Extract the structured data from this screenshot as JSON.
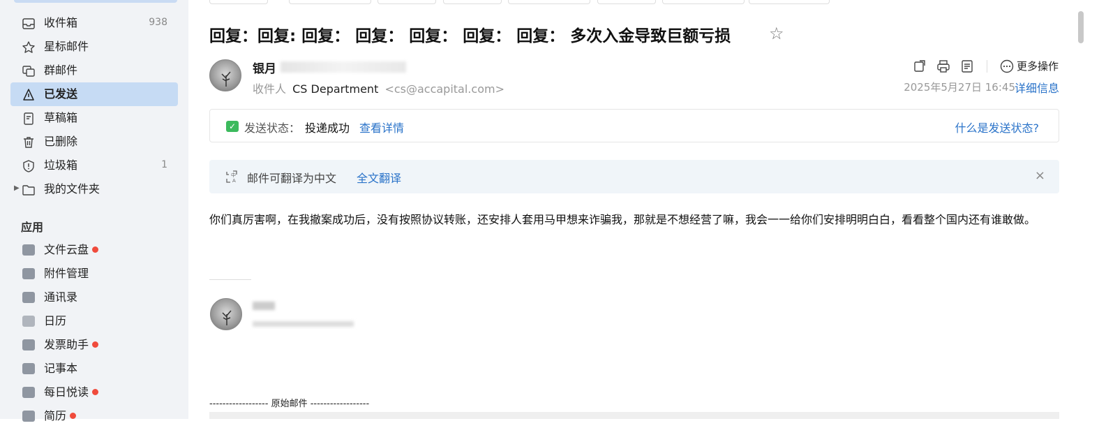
{
  "sidebar": {
    "folders": [
      {
        "label": "收件箱",
        "count": "938",
        "icon": "inbox-icon",
        "active": false
      },
      {
        "label": "星标邮件",
        "count": "",
        "icon": "star-icon",
        "active": false
      },
      {
        "label": "群邮件",
        "count": "",
        "icon": "group-mail-icon",
        "active": false
      },
      {
        "label": "已发送",
        "count": "",
        "icon": "sent-icon",
        "active": true
      },
      {
        "label": "草稿箱",
        "count": "",
        "icon": "draft-icon",
        "active": false
      },
      {
        "label": "已删除",
        "count": "",
        "icon": "trash-icon",
        "active": false
      },
      {
        "label": "垃圾箱",
        "count": "1",
        "icon": "shield-icon",
        "active": false
      },
      {
        "label": "我的文件夹",
        "count": "",
        "icon": "folder-icon",
        "active": false
      }
    ],
    "apps_title": "应用",
    "apps": [
      {
        "label": "文件云盘",
        "badge": true,
        "icon": "cloud-drive-icon"
      },
      {
        "label": "附件管理",
        "badge": false,
        "icon": "attachment-icon"
      },
      {
        "label": "通讯录",
        "badge": false,
        "icon": "contacts-icon"
      },
      {
        "label": "日历",
        "badge": false,
        "icon": "calendar-icon"
      },
      {
        "label": "发票助手",
        "badge": true,
        "icon": "invoice-icon"
      },
      {
        "label": "记事本",
        "badge": false,
        "icon": "notepad-icon"
      },
      {
        "label": "每日悦读",
        "badge": true,
        "icon": "reading-icon"
      },
      {
        "label": "简历",
        "badge": true,
        "icon": "resume-icon"
      }
    ]
  },
  "mail": {
    "subject": "回复：回复: 回复： 回复： 回复： 回复： 回复： 多次入金导致巨额亏损",
    "sender_name": "银月",
    "recipient_label": "收件人",
    "recipient_name": "CS Department",
    "recipient_email": "<cs@accapital.com>",
    "more_ops": "更多操作",
    "date": "2025年5月27日 16:45",
    "detail_link": "详细信息",
    "status_label": "发送状态：",
    "status_value": "投递成功",
    "status_link": "查看详情",
    "status_help": "什么是发送状态?",
    "translate_text": "邮件可翻译为中文",
    "translate_link": "全文翻译",
    "close_symbol": "×",
    "body": "你们真厉害啊，在我撤案成功后，没有按照协议转账，还安排人套用马甲想来诈骗我，那就是不想经营了嘛，我会一一给你们安排明明白白，看看整个国内还有谁敢做。",
    "original_divider": "------------------ 原始邮件 ------------------"
  },
  "colors": {
    "accent": "#2a73c9",
    "active_bg": "#c6dbf4",
    "badge": "#f04b3c",
    "success": "#3cba5d"
  }
}
